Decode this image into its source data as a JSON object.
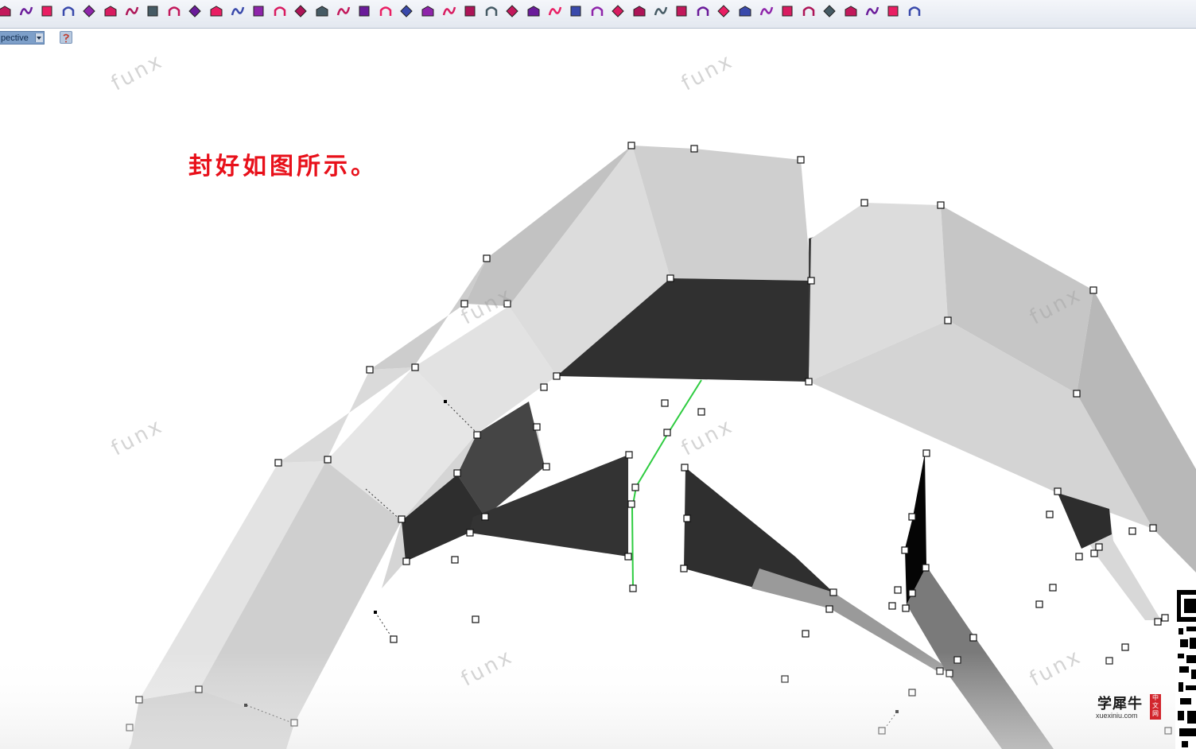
{
  "toolbar": {
    "icons": [
      "sweep-icon",
      "rail-icon",
      "extrude-icon",
      "box-icon",
      "fillet-icon",
      "trim-icon",
      "split-icon",
      "join-icon",
      "arc-icon",
      "blend-icon",
      "offset-icon",
      "cap-icon",
      "solid-icon",
      "shell-icon",
      "boolean-icon",
      "wireframe-icon",
      "checkbox-icon",
      "grid-icon",
      "surface-icon",
      "mesh-icon",
      "move-icon",
      "copy-icon",
      "array-icon",
      "rotate-icon",
      "scale-icon",
      "mirror-icon",
      "pipe-icon",
      "loft-icon",
      "revolve-icon",
      "network-icon",
      "patch-icon",
      "unroll-icon",
      "explode-icon",
      "point-icon",
      "control-point-icon",
      "star-icon",
      "polygon-icon",
      "spiral-icon",
      "layer-icon",
      "plane-icon",
      "dimension-icon",
      "x-icon",
      "cube-render-icon",
      "gear-icon"
    ]
  },
  "viewport": {
    "tab_label": "pective",
    "help_icon": "help-icon"
  },
  "caption": "封好如图所示。",
  "watermark": "funx",
  "logo": {
    "brand": "学犀牛",
    "tag": "中文网",
    "url": "xuexiniu.com"
  },
  "colors": {
    "caption": "#e8101a",
    "surface_light": "#d9d9d9",
    "surface_dark": "#303030",
    "selected_curve": "#2ecc40",
    "control_point": "#000000"
  }
}
